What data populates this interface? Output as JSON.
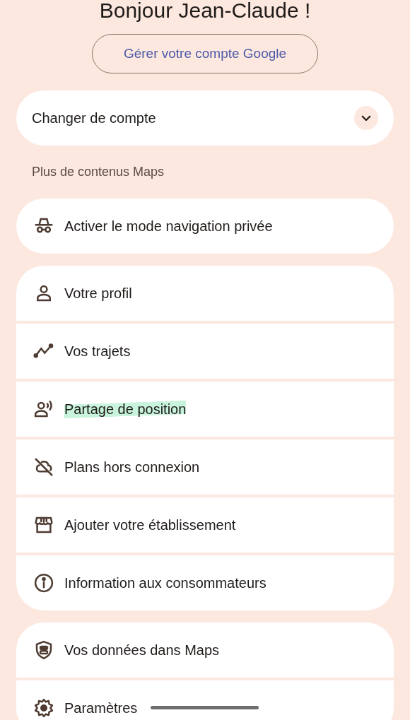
{
  "greeting": "Bonjour Jean-Claude !",
  "manage_account_button": "Gérer votre compte Google",
  "account_switcher": {
    "label": "Changer de compte",
    "expanded": false
  },
  "section_label": "Plus de contenus Maps",
  "groups": [
    {
      "items": [
        {
          "label": "Activer le mode navigation privée",
          "highlighted": false
        }
      ]
    },
    {
      "items": [
        {
          "label": "Votre profil",
          "highlighted": false
        },
        {
          "label": "Vos trajets",
          "highlighted": false
        },
        {
          "label": "Partage de position",
          "highlighted": true
        },
        {
          "label": "Plans hors connexion",
          "highlighted": false
        },
        {
          "label": "Ajouter votre établissement",
          "highlighted": false
        },
        {
          "label": "Information aux consommateurs",
          "highlighted": false
        }
      ]
    },
    {
      "items": [
        {
          "label": "Vos données dans Maps",
          "highlighted": false
        },
        {
          "label": "Paramètres",
          "highlighted": false
        }
      ]
    }
  ]
}
